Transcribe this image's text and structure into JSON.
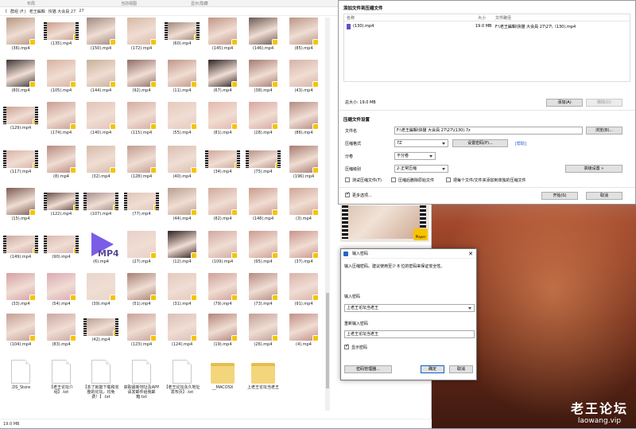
{
  "explorer": {
    "ribbon": [
      "布局",
      "当前视图",
      "显示/隐藏"
    ],
    "breadcrumb": [
      "《",
      "群组 (F:)",
      "老王編輯",
      "快猫 大会員 27",
      "27"
    ],
    "status": "19.0 MB",
    "files": [
      {
        "name": "(36).mp4",
        "c": "#b59682",
        "film": false
      },
      {
        "name": "(135).mp4",
        "c": "#c89a88",
        "film": true
      },
      {
        "name": "(150).mp4",
        "c": "#a08a80",
        "film": false
      },
      {
        "name": "(172).mp4",
        "c": "#d7b8a6",
        "film": false
      },
      {
        "name": "(60).mp4",
        "c": "#9b8176",
        "film": true
      },
      {
        "name": "(145).mp4",
        "c": "#c09585",
        "film": false
      },
      {
        "name": "(146).mp4",
        "c": "#6b5953",
        "film": false
      },
      {
        "name": "(85).mp4",
        "c": "#b89585",
        "film": false
      },
      {
        "name": "(80).mp4",
        "c": "#3d3535",
        "film": false
      },
      {
        "name": "(105).mp4",
        "c": "#d6b3a0",
        "film": false
      },
      {
        "name": "(144).mp4",
        "c": "#c6b099",
        "film": false
      },
      {
        "name": "(92).mp4",
        "c": "#8f6d67",
        "film": false
      },
      {
        "name": "(11).mp4",
        "c": "#c0968a",
        "film": false
      },
      {
        "name": "(67).mp4",
        "c": "#2e2222",
        "film": false
      },
      {
        "name": "(38).mp4",
        "c": "#a47a70",
        "film": false
      },
      {
        "name": "(43).mp4",
        "c": "#d6b2a8",
        "film": false
      },
      {
        "name": "(129).mp4",
        "c": "#c8a090",
        "film": true
      },
      {
        "name": "(174).mp4",
        "c": "#c89d93",
        "film": false
      },
      {
        "name": "(140).mp4",
        "c": "#e3c2b8",
        "film": false
      },
      {
        "name": "(115).mp4",
        "c": "#d4aca2",
        "film": false
      },
      {
        "name": "(55).mp4",
        "c": "#e7c9bf",
        "film": false
      },
      {
        "name": "(81).mp4",
        "c": "#e4b9ac",
        "film": false
      },
      {
        "name": "(28).mp4",
        "c": "#d7a7a1",
        "film": false
      },
      {
        "name": "(86).mp4",
        "c": "#b38c82",
        "film": false
      },
      {
        "name": "(117).mp4",
        "c": "#d9b0a4",
        "film": true
      },
      {
        "name": "(8).mp4",
        "c": "#b88a7f",
        "film": false
      },
      {
        "name": "(32).mp4",
        "c": "#d4bba8",
        "film": false
      },
      {
        "name": "(128).mp4",
        "c": "#c19d91",
        "film": false
      },
      {
        "name": "(40).mp4",
        "c": "#d9bfb3",
        "film": false
      },
      {
        "name": "(34).mp4",
        "c": "#cda597",
        "film": true
      },
      {
        "name": "(75).mp4",
        "c": "#b58d84",
        "film": true
      },
      {
        "name": "(196).mp4",
        "c": "#a67a70",
        "film": false
      },
      {
        "name": "(15).mp4",
        "c": "#7a5a52",
        "film": false
      },
      {
        "name": "(122).mp4",
        "c": "#5f4540",
        "film": true
      },
      {
        "name": "(107).mp4",
        "c": "#a08c8a",
        "film": true
      },
      {
        "name": "(77).mp4",
        "c": "#e0c4b8",
        "film": true
      },
      {
        "name": "(44).mp4",
        "c": "#b8a090",
        "film": false
      },
      {
        "name": "(82).mp4",
        "c": "#d0aa9d",
        "film": false
      },
      {
        "name": "(148).mp4",
        "c": "#c99b8c",
        "film": false
      },
      {
        "name": "(3).mp4",
        "c": "#cfa597",
        "film": false
      },
      {
        "name": "(149).mp4",
        "c": "#c9a5a0",
        "film": true
      },
      {
        "name": "(90).mp4",
        "c": "#d8b8b0",
        "film": true
      },
      {
        "name": "(6).mp4",
        "c": "#ffffff",
        "film": false,
        "mp4": true
      },
      {
        "name": "(27).mp4",
        "c": "#e8d0c8",
        "film": false
      },
      {
        "name": "(12).mp4",
        "c": "#2f2020",
        "film": false
      },
      {
        "name": "(109).mp4",
        "c": "#d0a9a2",
        "film": false
      },
      {
        "name": "(95).mp4",
        "c": "#cd9c90",
        "film": false
      },
      {
        "name": "(37).mp4",
        "c": "#c8948a",
        "film": false
      },
      {
        "name": "(33).mp4",
        "c": "#d6a0a6",
        "film": false
      },
      {
        "name": "(54).mp4",
        "c": "#dca9b4",
        "film": false
      },
      {
        "name": "(39).mp4",
        "c": "#e8d6cc",
        "film": false
      },
      {
        "name": "(51).mp4",
        "c": "#a88074",
        "film": false
      },
      {
        "name": "(31).mp4",
        "c": "#e4c9bf",
        "film": false
      },
      {
        "name": "(79).mp4",
        "c": "#cfa09a",
        "film": false
      },
      {
        "name": "(73).mp4",
        "c": "#b58c82",
        "film": false
      },
      {
        "name": "(91).mp4",
        "c": "#d9b3aa",
        "film": false
      },
      {
        "name": "(104).mp4",
        "c": "#c49f95",
        "film": false
      },
      {
        "name": "(83).mp4",
        "c": "#c9a7a3",
        "film": false
      },
      {
        "name": "(42).mp4",
        "c": "#b69c8e",
        "film": true
      },
      {
        "name": "(123).mp4",
        "c": "#c8a299",
        "film": false
      },
      {
        "name": "(124).mp4",
        "c": "#d9c0b8",
        "film": false
      },
      {
        "name": "(19).mp4",
        "c": "#b3847a",
        "film": false
      },
      {
        "name": "(26).mp4",
        "c": "#c0a098",
        "film": false
      },
      {
        "name": "(4).mp4",
        "c": "#c28f87",
        "film": false
      }
    ],
    "docs": [
      {
        "name": ".DS_Store",
        "kind": "doc"
      },
      {
        "name": "【老王论坛介绍】.txt",
        "kind": "doc"
      },
      {
        "name": "【本了就能下载和完整的论坛，均免费！】.txt",
        "kind": "doc"
      },
      {
        "name": "获取最新地址及APP请发邮件给我邮箱.txt",
        "kind": "doc"
      },
      {
        "name": "【老王论坛永久地址发布页】.txt",
        "kind": "doc"
      },
      {
        "name": "__MACOSX",
        "kind": "folder"
      },
      {
        "name": "上老王论坛当老王",
        "kind": "folder"
      }
    ],
    "mp4_label": "MP4"
  },
  "archive": {
    "title": "添加文件到压缩文件",
    "col_name": "名称",
    "col_size": "大小",
    "col_path": "文件路径",
    "row_name": "(130).mp4",
    "row_size": "19.0 MB",
    "row_path": "F:\\老王編輯\\快猫 大会員 27\\27\\（130).mp4",
    "total": "总大小: 19.0 MB",
    "add": "添加(A)",
    "remove": "删除(D)",
    "settings_title": "压缩文件设置",
    "lbl_filename": "文件名",
    "filename": "F:\\老王編輯\\快猫 大会員 27\\27\\(130).7z",
    "browse": "浏览(B)...",
    "lbl_format": "压缩格式",
    "format": "7Z",
    "set_password": "设置密码(P)...",
    "help": "[帮助]",
    "lbl_volume": "分卷",
    "volume": "不分卷",
    "lbl_level": "压缩级别",
    "level": "2-正常压缩",
    "advanced": "高级设置 »",
    "opt_test": "测试压缩文件(T)",
    "opt_delete": "压缩后删除原始文件",
    "opt_each": "把每个文件/文件夹添加到单独的压缩文件",
    "more": "更多选项...",
    "start": "开始(S)",
    "cancel": "取消"
  },
  "preview": {
    "player": "Player"
  },
  "password": {
    "title": "输入密码",
    "hint": "输入压缩密码。建议使用至少 8 位的密码来保证安全性。",
    "lbl_enter": "输入密码",
    "value": "上老王论坛当老王",
    "lbl_reenter": "重新输入密码",
    "value2": "上老王论坛当老王",
    "show": "显示密码",
    "manager": "密码管理器...",
    "ok": "确定",
    "cancel": "取消"
  },
  "watermark": {
    "line1": "老王论坛",
    "line2": "laowang.vip"
  }
}
